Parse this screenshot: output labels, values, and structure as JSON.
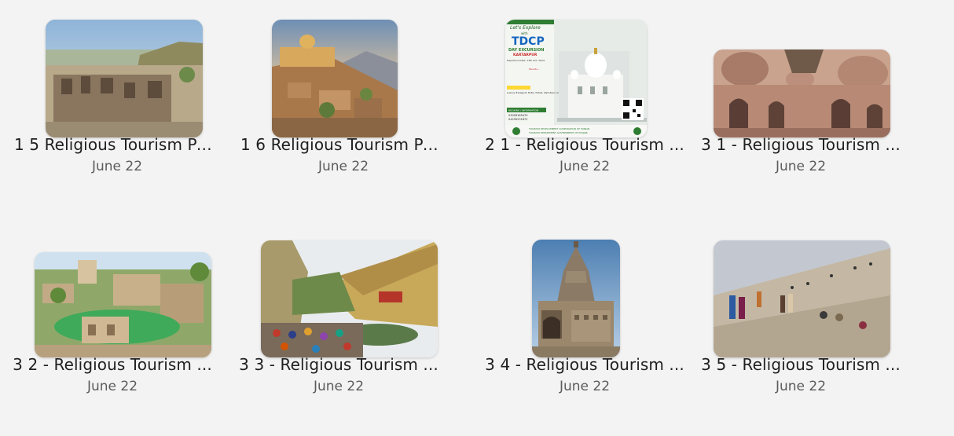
{
  "files": [
    {
      "name": "1 5 Religious Tourism Pa...",
      "date": "June 22"
    },
    {
      "name": "1 6 Religious Tourism Pa...",
      "date": "June 22"
    },
    {
      "name": "2 1 - Religious Tourism ...",
      "date": "June 22"
    },
    {
      "name": "3 1 - Religious Tourism ...",
      "date": "June 22"
    },
    {
      "name": "3 2 - Religious Tourism ...",
      "date": "June 22"
    },
    {
      "name": "3 3 - Religious Tourism ...",
      "date": "June 22"
    },
    {
      "name": "3 4 - Religious Tourism ...",
      "date": "June 22"
    },
    {
      "name": "3 5 - Religious Tourism ...",
      "date": "June 22"
    }
  ],
  "poster": {
    "tagline": "Let's Explore",
    "with": "with",
    "brand": "TDCP",
    "subtitle": "DAY EXCURSION",
    "place": "KARTARPUR",
    "date_line": "Departure Date: 13th Oct, 2024",
    "fare": "Fare Rs. -",
    "features": "Luxury Transport, Entry Ticket, Visit Zero Line, Music, Guide Services.",
    "booking": "BOOKING / INFORMATION",
    "phone1": "03028165479",
    "phone2": "04299231872",
    "footer1": "TOURISM DEVELOPMENT CORPORATION OF PUNJAB",
    "footer2": "TOURISM DEPARTMENT GOVERNMENT OF PUNJAB"
  },
  "colors": {
    "background": "#f3f3f3",
    "name_text": "#1f1f1f",
    "date_text": "#5b5b5b"
  }
}
